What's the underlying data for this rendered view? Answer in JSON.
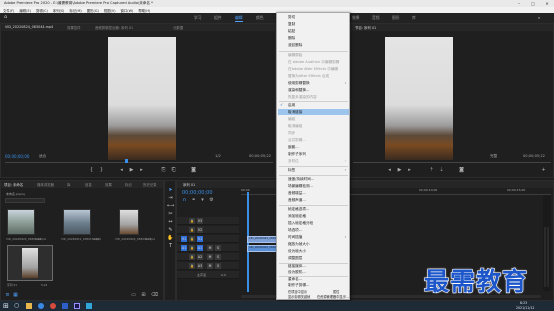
{
  "window": {
    "title": "Adobe Premiere Pro 2020 - E:\\最需教育\\Adobe Premiere Pro Captured Audio\\未命名 *",
    "controls": [
      "–",
      "□",
      "✕"
    ]
  },
  "menubar": [
    "文件(F)",
    "编辑(E)",
    "剪辑(C)",
    "序列(S)",
    "标记(M)",
    "图形(G)",
    "视图(V)",
    "窗口(W)",
    "帮助(H)"
  ],
  "workspaces": [
    "学习",
    "组件",
    "编辑",
    "颜色",
    "效果",
    "音频",
    "图形",
    "库"
  ],
  "source_monitor": {
    "tabs": [
      "VID_20220824_083044.mp4",
      "效果控件",
      "音频剪辑混合器: 序列 01",
      "元数据"
    ],
    "timecode_left": "00;00;00;00",
    "fit": "适合",
    "page": "1/2",
    "timecode_right": "00;00;05;22"
  },
  "program_monitor": {
    "tabs": [
      "节目: 序列 01"
    ],
    "timecode_left": "00;00;00;00",
    "fit": "完整",
    "timecode_right": "00;00;05;22"
  },
  "project": {
    "tabs": [
      "项目: 未命名",
      "媒体浏览器",
      "库",
      "信息",
      "效果",
      "标记",
      "历史记录"
    ],
    "project_name": "未命名.prproj",
    "items": [
      {
        "name": "VID_20220824_083044.mp4",
        "duration": "5;22"
      },
      {
        "name": "VID_20220811_095015.mp4",
        "duration": "4;26"
      },
      {
        "name": "VID_20220824_083039.mp4",
        "duration": "6;13"
      },
      {
        "name": "序列 01",
        "duration": "5;22"
      }
    ]
  },
  "timeline": {
    "tab": "序列 01",
    "timecode": "00;00;00;00",
    "ruler": [
      "00;00",
      "00;00;05;00",
      "00;00;10;00",
      "00;00;15;00"
    ],
    "tracks": [
      "V3",
      "V2",
      "V1",
      "A1",
      "A2",
      "A3"
    ],
    "master": "主声道",
    "master_value": "0.0",
    "clips": [
      {
        "label": "VID_20220824_083044.mp4 [V]"
      },
      {
        "label": "VID_20220824_083044.mp4 [A]"
      }
    ]
  },
  "context_menu": {
    "items": [
      {
        "label": "剪切",
        "enabled": true
      },
      {
        "label": "复制",
        "enabled": true
      },
      {
        "label": "粘贴",
        "enabled": true
      },
      {
        "label": "删除",
        "enabled": true
      },
      {
        "label": "波纹删除",
        "enabled": true
      },
      {
        "label": "编辑原始",
        "enabled": false
      },
      {
        "label": "在 Adobe Audition 中编辑剪辑",
        "enabled": false
      },
      {
        "label": "在Adobe After Effects 中编辑",
        "enabled": false
      },
      {
        "label": "替换为After Effects 合成",
        "enabled": false
      },
      {
        "label": "使用剪辑替换",
        "enabled": true,
        "submenu": true
      },
      {
        "label": "渲染和替换...",
        "enabled": true
      },
      {
        "label": "恢复未渲染的内容",
        "enabled": false
      },
      {
        "label": "启用",
        "enabled": true,
        "checked": true
      },
      {
        "label": "取消链接",
        "enabled": true,
        "highlighted": true
      },
      {
        "label": "编组",
        "enabled": false
      },
      {
        "label": "取消编组",
        "enabled": false
      },
      {
        "label": "同步",
        "enabled": false
      },
      {
        "label": "合并剪辑...",
        "enabled": false
      },
      {
        "label": "嵌套...",
        "enabled": true
      },
      {
        "label": "制作子序列",
        "enabled": true
      },
      {
        "label": "多机位",
        "enabled": false,
        "submenu": true
      },
      {
        "label": "标签",
        "enabled": true,
        "submenu": true
      },
      {
        "label": "速度/持续时间...",
        "enabled": true
      },
      {
        "label": "场景编辑检测...",
        "enabled": true
      },
      {
        "label": "音频增益...",
        "enabled": true
      },
      {
        "label": "音频声道...",
        "enabled": true
      },
      {
        "label": "帧定格选项...",
        "enabled": true
      },
      {
        "label": "添加帧定格",
        "enabled": true
      },
      {
        "label": "插入帧定格分段",
        "enabled": true
      },
      {
        "label": "场选项...",
        "enabled": true
      },
      {
        "label": "时间插值",
        "enabled": true,
        "submenu": true
      },
      {
        "label": "缩放为帧大小",
        "enabled": true
      },
      {
        "label": "设为帧大小",
        "enabled": true
      },
      {
        "label": "调整图层",
        "enabled": true
      },
      {
        "label": "链接媒体...",
        "enabled": true
      },
      {
        "label": "设为脱机...",
        "enabled": true
      },
      {
        "label": "重命名...",
        "enabled": true
      },
      {
        "label": "制作子剪辑...",
        "enabled": true
      },
      {
        "label": "在项目中显示",
        "enabled": true
      },
      {
        "label": "在资源管理器中显示...",
        "enabled": true
      },
      {
        "label": "属性",
        "enabled": true
      },
      {
        "label": "显示剪辑关键帧",
        "enabled": true,
        "submenu": true
      }
    ]
  },
  "taskbar": {
    "time": "8:23",
    "date": "2021/11/12"
  },
  "watermark": "最需教育"
}
